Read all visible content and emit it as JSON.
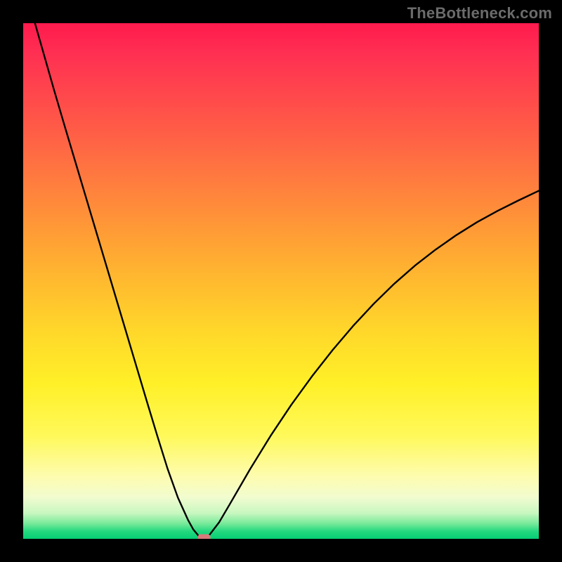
{
  "watermark": {
    "text": "TheBottleneck.com"
  },
  "chart_data": {
    "type": "line",
    "title": "",
    "xlabel": "",
    "ylabel": "",
    "xlim": [
      0,
      100
    ],
    "ylim": [
      0,
      100
    ],
    "grid": false,
    "series": [
      {
        "name": "bottleneck-curve",
        "x": [
          0,
          2,
          4,
          6,
          8,
          10,
          12,
          14,
          16,
          18,
          20,
          22,
          24,
          26,
          28,
          30,
          32,
          33,
          34,
          34.8,
          35.5,
          36,
          38,
          40,
          44,
          48,
          52,
          56,
          60,
          64,
          68,
          72,
          76,
          80,
          84,
          88,
          92,
          96,
          100
        ],
        "values": [
          108,
          101,
          94,
          87,
          80.2,
          73.5,
          66.8,
          60.1,
          53.4,
          46.7,
          40,
          33.3,
          26.6,
          20,
          13.6,
          8,
          3.6,
          1.8,
          0.6,
          0.15,
          0.15,
          0.6,
          3.2,
          6.6,
          13.5,
          20,
          26,
          31.5,
          36.6,
          41.3,
          45.6,
          49.5,
          53,
          56.1,
          58.9,
          61.4,
          63.6,
          65.6,
          67.5
        ]
      }
    ],
    "annotations": [
      {
        "name": "minimum-marker",
        "x": 35.1,
        "y": 0.0,
        "color": "#d87a7a"
      }
    ],
    "background_gradient": {
      "stops": [
        {
          "pos": 0.0,
          "color": "#ff1a4d"
        },
        {
          "pos": 0.5,
          "color": "#ffba2f"
        },
        {
          "pos": 0.75,
          "color": "#fff43a"
        },
        {
          "pos": 1.0,
          "color": "#06cd75"
        }
      ]
    }
  }
}
